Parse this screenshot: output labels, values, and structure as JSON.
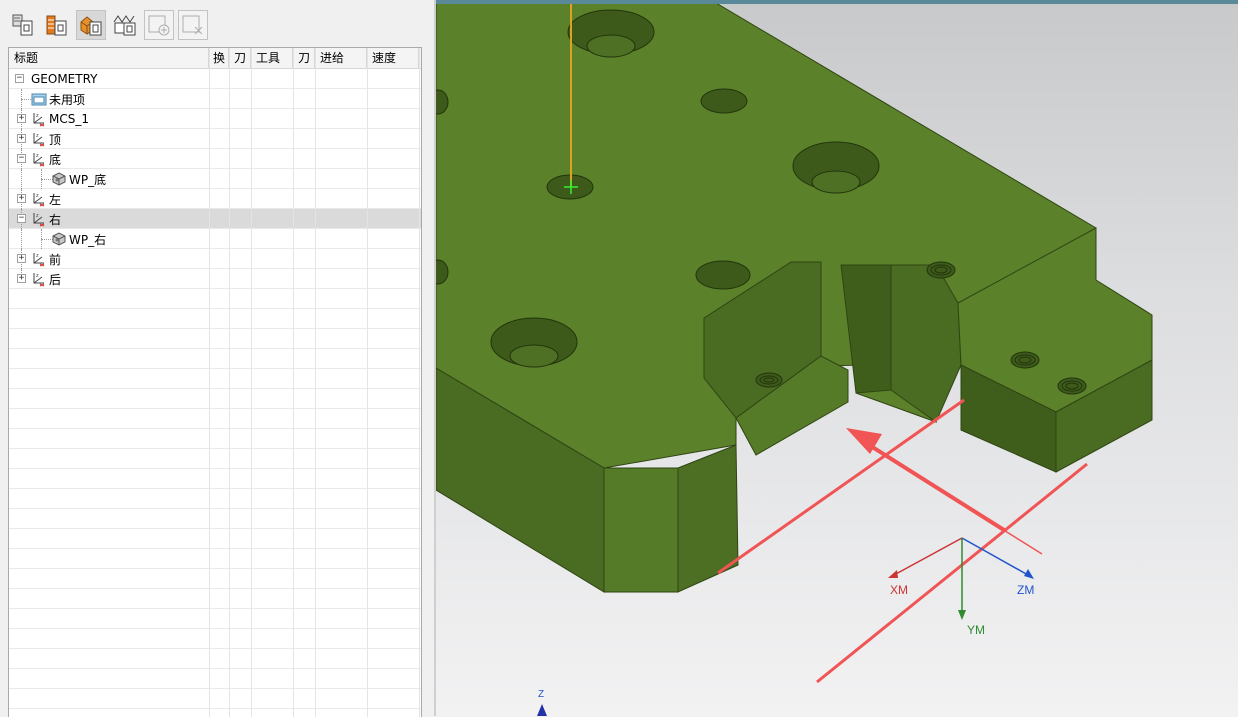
{
  "toolbar": {
    "buttons": [
      {
        "icon": "program-order-view-icon"
      },
      {
        "icon": "machine-tool-view-icon"
      },
      {
        "icon": "geometry-view-icon",
        "active": true
      },
      {
        "icon": "machining-method-view-icon"
      },
      {
        "icon": "add-object-icon",
        "disabled": true
      },
      {
        "icon": "remove-object-icon",
        "disabled": true
      }
    ]
  },
  "navigator": {
    "columns": [
      "标题",
      "换",
      "刀",
      "工具",
      "刀",
      "进给",
      "速度"
    ],
    "rows": [
      {
        "label": "GEOMETRY",
        "level": 0,
        "expander": "minus",
        "icon": "none"
      },
      {
        "label": "未用项",
        "level": 1,
        "expander": "none",
        "icon": "folder-icon"
      },
      {
        "label": "MCS_1",
        "level": 1,
        "expander": "plus",
        "icon": "mcs-icon"
      },
      {
        "label": "顶",
        "level": 1,
        "expander": "plus",
        "icon": "mcs-icon"
      },
      {
        "label": "底",
        "level": 1,
        "expander": "minus",
        "icon": "mcs-icon"
      },
      {
        "label": "WP_底",
        "level": 2,
        "expander": "none",
        "icon": "workpiece-icon"
      },
      {
        "label": "左",
        "level": 1,
        "expander": "plus",
        "icon": "mcs-icon"
      },
      {
        "label": "右",
        "level": 1,
        "expander": "minus",
        "icon": "mcs-icon",
        "selected": true
      },
      {
        "label": "WP_右",
        "level": 2,
        "expander": "none",
        "icon": "workpiece-icon"
      },
      {
        "label": "前",
        "level": 1,
        "expander": "plus",
        "icon": "mcs-icon"
      },
      {
        "label": "后",
        "level": 1,
        "expander": "plus",
        "icon": "mcs-icon"
      }
    ]
  },
  "viewport": {
    "axes": {
      "xm": "XM",
      "ym": "YM",
      "zm": "ZM",
      "z": "Z"
    },
    "colors": {
      "part_top": "#5b812b",
      "part_side": "#4a6b22",
      "part_dark": "#3d5a1a",
      "arrow": "#f05454",
      "xm": "#cc3333",
      "ym": "#2e8b2e",
      "zm": "#2255cc",
      "tool_line": "#e0a020"
    }
  }
}
